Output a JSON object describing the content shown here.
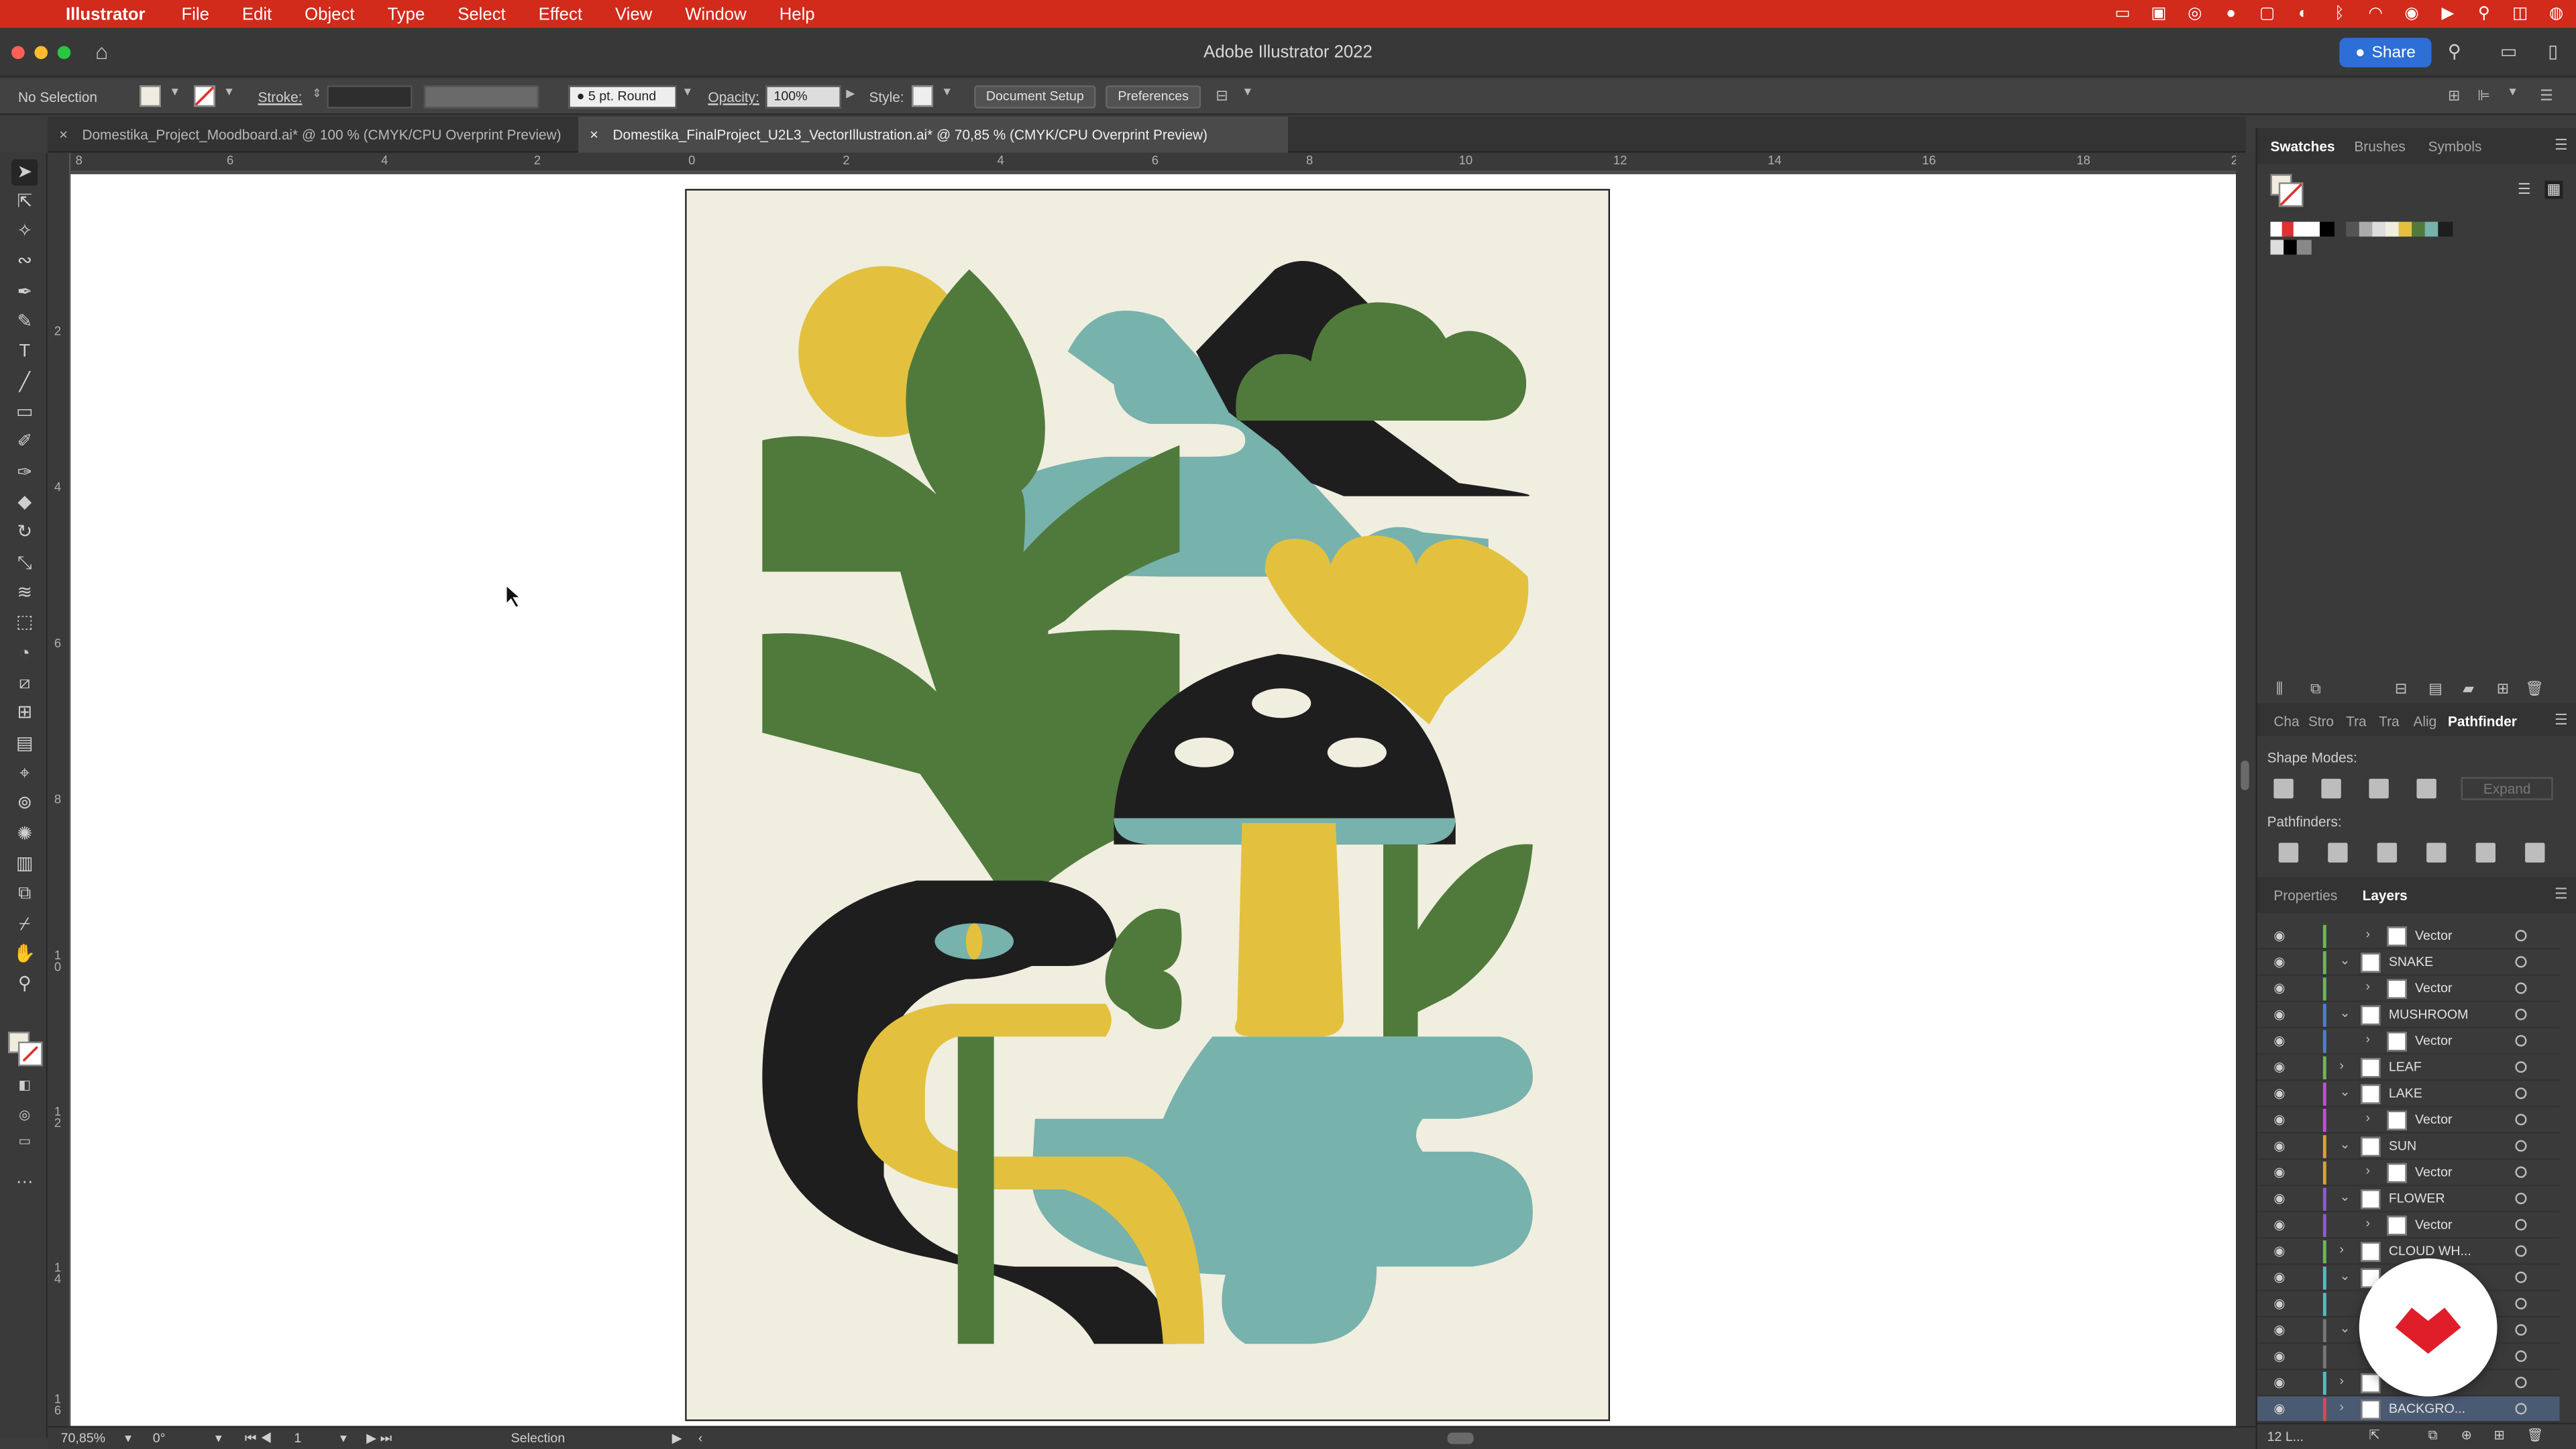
{
  "menubar": {
    "app_name": "Illustrator",
    "items": [
      "File",
      "Edit",
      "Object",
      "Type",
      "Select",
      "Effect",
      "View",
      "Window",
      "Help"
    ]
  },
  "window": {
    "title": "Adobe Illustrator 2022",
    "share_label": "Share"
  },
  "control": {
    "selection": "No Selection",
    "stroke_label": "Stroke:",
    "brush_value": "5 pt. Round",
    "opacity_label": "Opacity:",
    "opacity_value": "100%",
    "style_label": "Style:",
    "doc_setup": "Document Setup",
    "preferences": "Preferences"
  },
  "tabs": [
    {
      "label": "Domestika_Project_Moodboard.ai* @ 100 % (CMYK/CPU Overprint Preview)",
      "active": false
    },
    {
      "label": "Domestika_FinalProject_U2L3_VectorIllustration.ai* @ 70,85 % (CMYK/CPU Overprint Preview)",
      "active": true
    }
  ],
  "ruler": {
    "h_ticks": [
      "8",
      "6",
      "4",
      "2",
      "0",
      "2",
      "4",
      "6",
      "8",
      "10",
      "12",
      "14",
      "16",
      "18",
      "2"
    ],
    "v_ticks": [
      "2",
      "4",
      "6",
      "8",
      "1\n0",
      "1\n2",
      "1\n4",
      "1\n6"
    ]
  },
  "status": {
    "zoom": "70,85%",
    "rotate": "0°",
    "artboard": "1",
    "tool": "Selection"
  },
  "swatches_panel": {
    "tabs": [
      "Swatches",
      "Brushes",
      "Symbols"
    ]
  },
  "pathfinder_panel": {
    "tabs": [
      "Cha",
      "Stro",
      "Tra",
      "Tra",
      "Alig",
      "Pathfinder"
    ],
    "shape_modes_label": "Shape Modes:",
    "pathfinders_label": "Pathfinders:",
    "expand_label": "Expand"
  },
  "layers_panel": {
    "tabs": [
      "Properties",
      "Layers"
    ],
    "footer_count": "12 L...",
    "rows": [
      {
        "name": "Vector",
        "level": 2,
        "color": "#6fb84a"
      },
      {
        "name": "SNAKE",
        "level": 1,
        "color": "#6fb84a",
        "expanded": true
      },
      {
        "name": "Vector",
        "level": 2,
        "color": "#6fb84a"
      },
      {
        "name": "MUSHROOM",
        "level": 1,
        "color": "#4f7bd8",
        "expanded": true
      },
      {
        "name": "Vector",
        "level": 2,
        "color": "#4f7bd8"
      },
      {
        "name": "LEAF",
        "level": 1,
        "color": "#6fb84a",
        "expanded": false
      },
      {
        "name": "LAKE",
        "level": 1,
        "color": "#c94ad8",
        "expanded": true
      },
      {
        "name": "Vector",
        "level": 2,
        "color": "#c94ad8"
      },
      {
        "name": "SUN",
        "level": 1,
        "color": "#e0a030",
        "expanded": true
      },
      {
        "name": "Vector",
        "level": 2,
        "color": "#e0a030"
      },
      {
        "name": "FLOWER",
        "level": 1,
        "color": "#8a5ad8",
        "expanded": true
      },
      {
        "name": "Vector",
        "level": 2,
        "color": "#8a5ad8"
      },
      {
        "name": "CLOUD WH...",
        "level": 1,
        "color": "#6fb84a",
        "expanded": false
      },
      {
        "name": "",
        "level": 1,
        "color": "#4fc0c0",
        "expanded": true
      },
      {
        "name": "",
        "level": 2,
        "color": "#4fc0c0"
      },
      {
        "name": "",
        "level": 1,
        "color": "#777777",
        "expanded": true
      },
      {
        "name": "",
        "level": 2,
        "color": "#777777"
      },
      {
        "name": "",
        "level": 1,
        "color": "#4fc0c0",
        "expanded": false
      },
      {
        "name": "BACKGRO...",
        "level": 1,
        "color": "#d84a4a",
        "expanded": false,
        "selected": true
      }
    ]
  },
  "colors": {
    "menubar": "#d22a1b",
    "artboard_bg": "#f0eedf",
    "leaf_green": "#4f7a3c",
    "sun_yellow": "#e3c13f",
    "teal": "#77b2ad",
    "black": "#1f1e1f"
  },
  "icons": {
    "tools": [
      "selection-tool-icon",
      "direct-selection-tool-icon",
      "magic-wand-icon",
      "lasso-icon",
      "pen-tool-icon",
      "curvature-icon",
      "type-tool-icon",
      "line-tool-icon",
      "rectangle-tool-icon",
      "paintbrush-icon",
      "shaper-icon",
      "eraser-icon",
      "rotate-icon",
      "scale-icon",
      "warp-icon",
      "free-transform-icon",
      "shape-builder-icon",
      "perspective-icon",
      "mesh-icon",
      "gradient-icon",
      "eyedropper-icon",
      "blend-icon",
      "symbol-sprayer-icon",
      "graph-icon",
      "artboard-icon",
      "slice-icon",
      "hand-icon",
      "zoom-icon"
    ]
  }
}
